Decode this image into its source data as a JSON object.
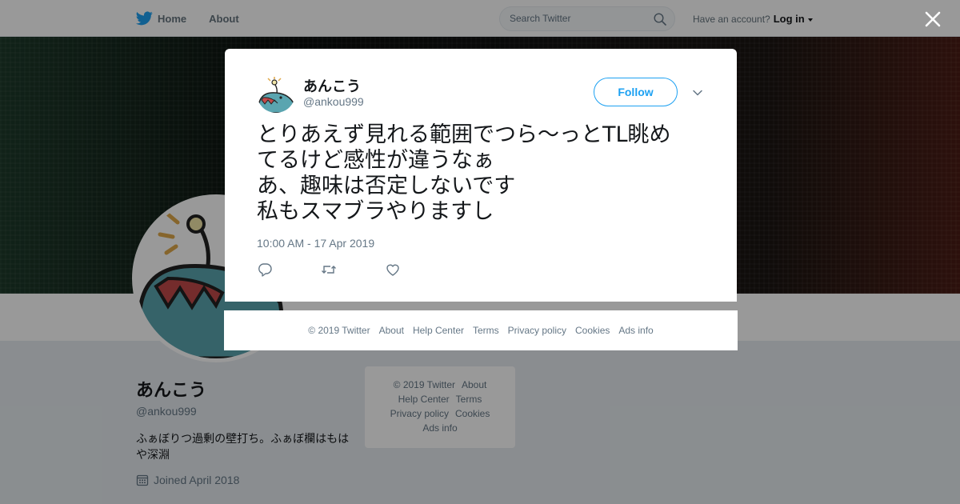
{
  "nav": {
    "home_label": "Home",
    "about_label": "About",
    "search_placeholder": "Search Twitter",
    "account_prompt": "Have an account?",
    "login_label": "Log in"
  },
  "profile": {
    "name": "あんこう",
    "handle": "@ankou999",
    "bio": "ふぁぼりつ過剰の壁打ち。ふぁぼ欄はもはや深淵",
    "joined": "Joined April 2018"
  },
  "side_footer": {
    "copyright": "© 2019 Twitter",
    "about": "About",
    "help": "Help Center",
    "terms": "Terms",
    "privacy": "Privacy policy",
    "cookies": "Cookies",
    "ads": "Ads info"
  },
  "tweet": {
    "author_name": "あんこう",
    "author_handle": "@ankou999",
    "follow_label": "Follow",
    "text": "とりあえず見れる範囲でつら～っとTL眺め\nてるけど感性が違うなぁ\nあ、趣味は否定しないです\n私もスマブラやりますし",
    "timestamp": "10:00 AM - 17 Apr 2019"
  },
  "modal_footer": {
    "copyright": "© 2019 Twitter",
    "about": "About",
    "help": "Help Center",
    "terms": "Terms",
    "privacy": "Privacy policy",
    "cookies": "Cookies",
    "ads": "Ads info"
  },
  "icons": {
    "brand": "twitter-bird-icon",
    "search": "search-icon",
    "close": "close-icon",
    "more": "chevron-down-icon",
    "reply": "reply-icon",
    "retweet": "retweet-icon",
    "like": "heart-icon",
    "calendar": "calendar-icon"
  },
  "colors": {
    "accent": "#1da1f2",
    "muted": "#657786",
    "fish": "#5aa5b0"
  }
}
